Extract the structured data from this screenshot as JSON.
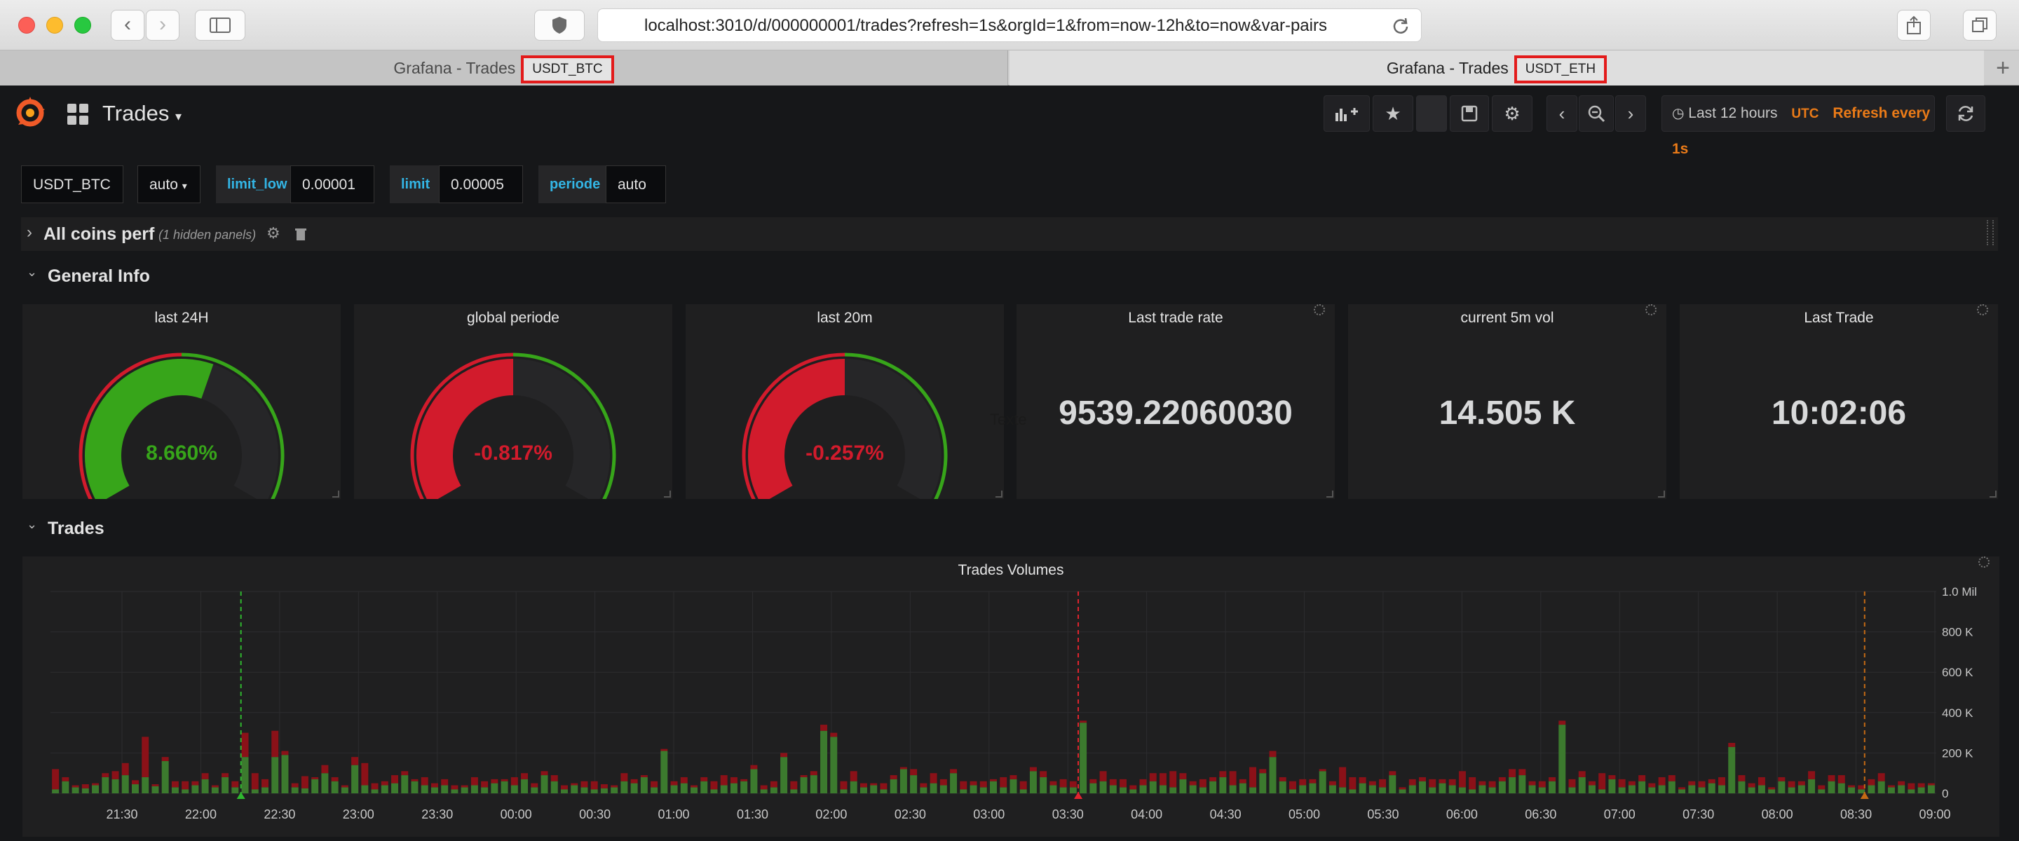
{
  "browser": {
    "url": "localhost:3010/d/000000001/trades?refresh=1s&orgId=1&from=now-12h&to=now&var-pairs",
    "tabs": [
      {
        "title": "Grafana - Trades",
        "badge": "USDT_BTC"
      },
      {
        "title": "Grafana - Trades",
        "badge": "USDT_ETH"
      }
    ]
  },
  "dashboard": {
    "title": "Trades",
    "time_range": "Last 12 hours",
    "timezone": "UTC",
    "refresh": "Refresh every 1s"
  },
  "variables": {
    "pair": "USDT_BTC",
    "interval": "auto",
    "limit_low_label": "limit_low",
    "limit_low": "0.00001",
    "limit_label": "limit",
    "limit": "0.00005",
    "periode_label": "periode",
    "periode": "auto"
  },
  "rows": {
    "all_coins": {
      "title": "All coins perf",
      "hidden": "(1 hidden panels)"
    },
    "general": {
      "title": "General Info"
    },
    "trades": {
      "title": "Trades"
    }
  },
  "gauges": [
    {
      "title": "last 24H",
      "value": "8.660%",
      "fraction": 0.58,
      "color": "#37a51a"
    },
    {
      "title": "global periode",
      "value": "-0.817%",
      "fraction": 0.5,
      "color": "#d21b2c"
    },
    {
      "title": "last 20m",
      "value": "-0.257%",
      "fraction": 0.5,
      "color": "#d21b2c"
    }
  ],
  "stats": [
    {
      "title": "Last trade rate",
      "value": "9539.22060030"
    },
    {
      "title": "current 5m vol",
      "value": "14.505 K"
    },
    {
      "title": "Last Trade",
      "value": "10:02:06"
    }
  ],
  "stray_text": "Texte",
  "colors": {
    "up": "#3c7a2e",
    "down": "#8b1118",
    "accent": "#eb7b18"
  },
  "chart_data": {
    "type": "bar",
    "title": "Trades Volumes",
    "x_ticks": [
      "21:30",
      "22:00",
      "22:30",
      "23:00",
      "23:30",
      "00:00",
      "00:30",
      "01:00",
      "01:30",
      "02:00",
      "02:30",
      "03:00",
      "03:30",
      "04:00",
      "04:30",
      "05:00",
      "05:30",
      "06:00",
      "06:30",
      "07:00",
      "07:30",
      "08:00",
      "08:30",
      "09:00"
    ],
    "y_ticks": [
      "0",
      "200 K",
      "400 K",
      "600 K",
      "800 K",
      "1.0 Mil"
    ],
    "ylim": [
      0,
      1000000
    ],
    "stacked": true,
    "series": [
      {
        "name": "buy",
        "color": "#3c7a2e",
        "values": [
          20000,
          60000,
          30000,
          25000,
          40000,
          80000,
          70000,
          90000,
          45000,
          80000,
          35000,
          160000,
          30000,
          20000,
          40000,
          70000,
          30000,
          80000,
          30000,
          180000,
          20000,
          30000,
          180000,
          190000,
          30000,
          25000,
          70000,
          100000,
          60000,
          30000,
          140000,
          40000,
          20000,
          40000,
          50000,
          90000,
          60000,
          40000,
          30000,
          40000,
          20000,
          30000,
          40000,
          30000,
          50000,
          60000,
          40000,
          70000,
          30000,
          90000,
          60000,
          20000,
          40000,
          30000,
          20000,
          25000,
          30000,
          60000,
          50000,
          80000,
          30000,
          210000,
          40000,
          50000,
          30000,
          60000,
          20000,
          40000,
          50000,
          60000,
          120000,
          20000,
          30000,
          180000,
          20000,
          80000,
          90000,
          310000,
          280000,
          20000,
          60000,
          30000,
          40000,
          20000,
          70000,
          120000,
          90000,
          30000,
          50000,
          40000,
          100000,
          20000,
          40000,
          30000,
          60000,
          30000,
          70000,
          20000,
          110000,
          80000,
          40000,
          30000,
          30000,
          350000,
          50000,
          60000,
          40000,
          30000,
          20000,
          40000,
          60000,
          40000,
          30000,
          70000,
          40000,
          30000,
          60000,
          80000,
          40000,
          50000,
          30000,
          100000,
          180000,
          60000,
          20000,
          40000,
          50000,
          110000,
          40000,
          30000,
          20000,
          50000,
          40000,
          30000,
          90000,
          20000,
          40000,
          60000,
          30000,
          50000,
          40000,
          30000,
          20000,
          40000,
          30000,
          60000,
          80000,
          90000,
          40000,
          30000,
          60000,
          340000,
          30000,
          80000,
          40000,
          20000,
          70000,
          30000,
          40000,
          60000,
          30000,
          40000,
          60000,
          20000,
          40000,
          30000,
          50000,
          40000,
          230000,
          60000,
          30000,
          40000,
          20000,
          60000,
          30000,
          40000,
          70000,
          20000,
          60000,
          50000,
          30000,
          20000,
          40000,
          60000,
          30000,
          40000,
          20000,
          30000,
          40000
        ]
      },
      {
        "name": "sell",
        "color": "#8b1118",
        "values": [
          100000,
          20000,
          10000,
          20000,
          10000,
          20000,
          40000,
          60000,
          20000,
          200000,
          10000,
          20000,
          30000,
          40000,
          20000,
          30000,
          10000,
          20000,
          30000,
          120000,
          80000,
          40000,
          130000,
          20000,
          20000,
          60000,
          10000,
          40000,
          20000,
          10000,
          40000,
          110000,
          30000,
          20000,
          40000,
          20000,
          10000,
          40000,
          20000,
          30000,
          20000,
          10000,
          40000,
          30000,
          20000,
          10000,
          40000,
          30000,
          20000,
          20000,
          30000,
          20000,
          10000,
          30000,
          40000,
          20000,
          10000,
          40000,
          20000,
          10000,
          30000,
          10000,
          20000,
          30000,
          10000,
          20000,
          40000,
          50000,
          30000,
          10000,
          20000,
          20000,
          30000,
          20000,
          40000,
          10000,
          20000,
          30000,
          20000,
          40000,
          50000,
          20000,
          10000,
          30000,
          20000,
          10000,
          30000,
          20000,
          50000,
          30000,
          20000,
          40000,
          20000,
          30000,
          10000,
          50000,
          20000,
          40000,
          20000,
          30000,
          20000,
          40000,
          30000,
          10000,
          20000,
          50000,
          30000,
          40000,
          20000,
          30000,
          40000,
          60000,
          80000,
          30000,
          20000,
          40000,
          20000,
          30000,
          70000,
          20000,
          100000,
          20000,
          30000,
          20000,
          40000,
          30000,
          20000,
          10000,
          20000,
          100000,
          60000,
          30000,
          20000,
          40000,
          20000,
          10000,
          30000,
          20000,
          40000,
          20000,
          30000,
          80000,
          60000,
          20000,
          30000,
          20000,
          40000,
          30000,
          20000,
          30000,
          20000,
          20000,
          40000,
          30000,
          20000,
          80000,
          20000,
          40000,
          20000,
          30000,
          20000,
          40000,
          30000,
          10000,
          20000,
          30000,
          20000,
          40000,
          20000,
          30000,
          20000,
          40000,
          10000,
          20000,
          30000,
          20000,
          40000,
          20000,
          30000,
          40000,
          10000,
          20000,
          30000,
          40000,
          10000,
          20000,
          30000,
          20000,
          10000,
          30000,
          20000
        ]
      }
    ],
    "annotations": [
      {
        "at": 0.101,
        "color": "#2fb82f"
      },
      {
        "at": 0.545,
        "color": "#e2242e"
      },
      {
        "at": 0.962,
        "color": "#c46a14"
      }
    ]
  }
}
